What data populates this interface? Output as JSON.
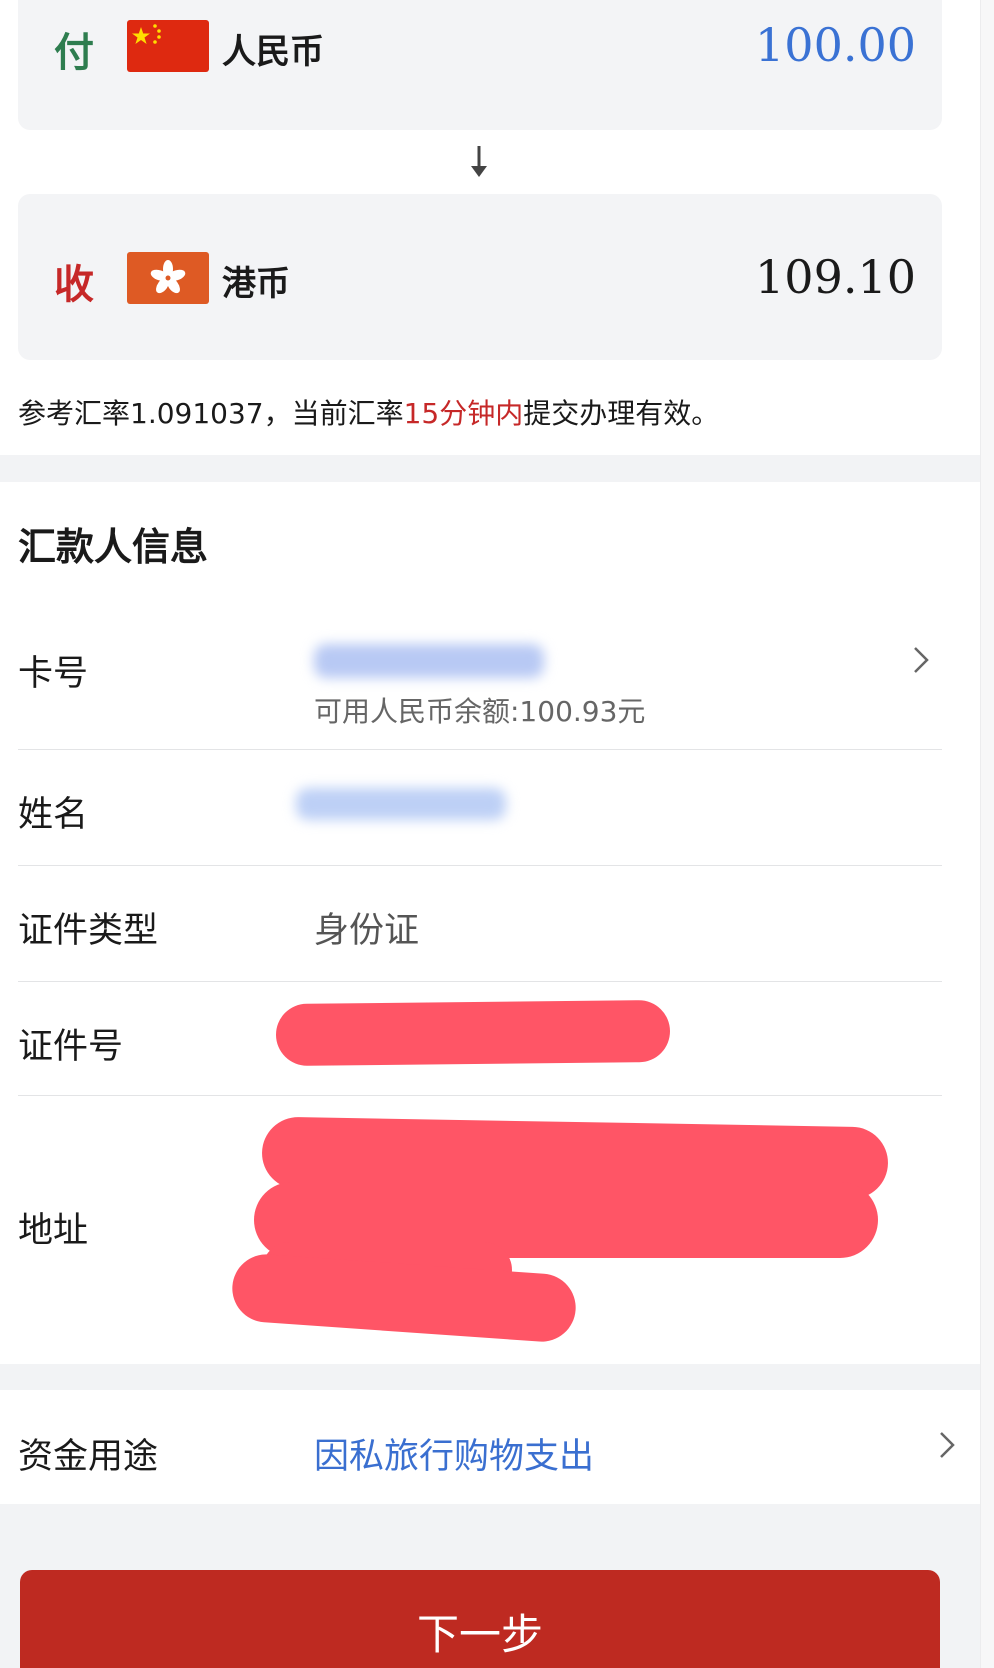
{
  "exchange": {
    "pay": {
      "tag": "付",
      "currency": "人民币",
      "amount": "100.00",
      "flag": "cn-flag-icon"
    },
    "receive": {
      "tag": "收",
      "currency": "港币",
      "amount": "109.10",
      "flag": "hk-flag-icon"
    },
    "rate_prefix": "参考汇率1.091037，当前汇率",
    "rate_highlight": "15分钟内",
    "rate_suffix": "提交办理有效。"
  },
  "remitter": {
    "title": "汇款人信息",
    "card": {
      "label": "卡号",
      "balance": "可用人民币余额:100.93元"
    },
    "name": {
      "label": "姓名"
    },
    "id_type": {
      "label": "证件类型",
      "value": "身份证"
    },
    "id_no": {
      "label": "证件号"
    },
    "address": {
      "label": "地址"
    }
  },
  "purpose": {
    "label": "资金用途",
    "value": "因私旅行购物支出"
  },
  "next_button": "下一步",
  "colors": {
    "primary_red": "#be2a21",
    "link_blue": "#3a6fd0",
    "pay_green": "#2e7d4f"
  }
}
